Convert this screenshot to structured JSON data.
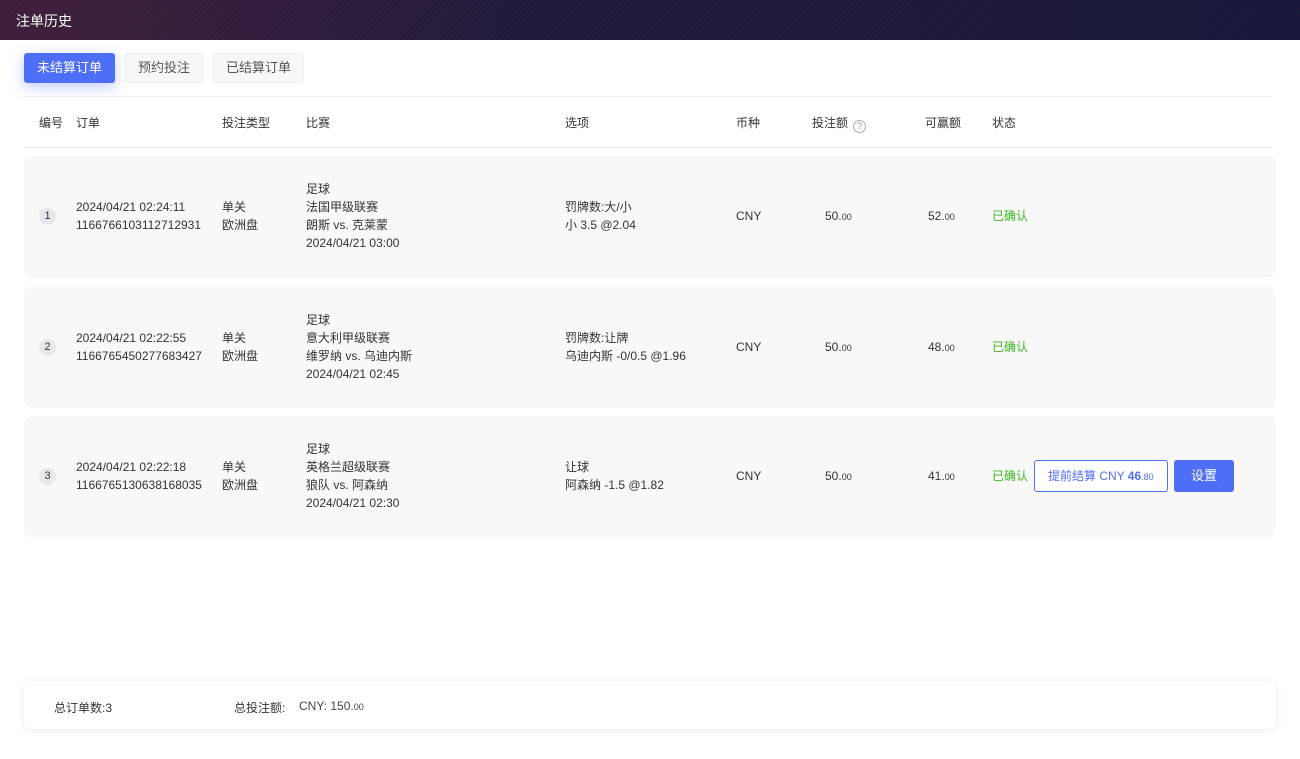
{
  "title": "注单历史",
  "tabs": [
    "未结算订单",
    "预约投注",
    "已结算订单"
  ],
  "columns": {
    "no": "编号",
    "order": "订单",
    "type": "投注类型",
    "match": "比赛",
    "option": "选项",
    "currency": "币种",
    "stake": "投注额",
    "win": "可赢额",
    "status": "状态"
  },
  "help_icon": "?",
  "rows": [
    {
      "no": "1",
      "time": "2024/04/21 02:24:11",
      "id": "1166766103112712931",
      "type1": "单关",
      "type2": "欧洲盘",
      "sport": "足球",
      "league": "法国甲级联赛",
      "teams": "朗斯 vs. 克莱蒙",
      "match_time": "2024/04/21 03:00",
      "opt1": "罚牌数:大/小",
      "opt2": "小 3.5 @2.04",
      "currency": "CNY",
      "stake_int": "50.",
      "stake_dec": "00",
      "win_int": "52.",
      "win_dec": "00",
      "status": "已确认"
    },
    {
      "no": "2",
      "time": "2024/04/21 02:22:55",
      "id": "1166765450277683427",
      "type1": "单关",
      "type2": "欧洲盘",
      "sport": "足球",
      "league": "意大利甲级联赛",
      "teams": "维罗纳 vs. 乌迪内斯",
      "match_time": "2024/04/21 02:45",
      "opt1": "罚牌数:让牌",
      "opt2": "乌迪内斯 -0/0.5 @1.96",
      "currency": "CNY",
      "stake_int": "50.",
      "stake_dec": "00",
      "win_int": "48.",
      "win_dec": "00",
      "status": "已确认"
    },
    {
      "no": "3",
      "time": "2024/04/21 02:22:18",
      "id": "1166765130638168035",
      "type1": "单关",
      "type2": "欧洲盘",
      "sport": "足球",
      "league": "英格兰超级联赛",
      "teams": "狼队 vs. 阿森纳",
      "match_time": "2024/04/21 02:30",
      "opt1": "让球",
      "opt2": "阿森纳 -1.5 @1.82",
      "currency": "CNY",
      "stake_int": "50.",
      "stake_dec": "00",
      "win_int": "41.",
      "win_dec": "00",
      "status": "已确认",
      "early_label": "提前结算 CNY ",
      "early_int": "46",
      "early_dec": ".80",
      "settings_label": "设置"
    }
  ],
  "footer": {
    "total_orders": "总订单数:3",
    "total_stake_label": "总投注额:",
    "total_stake_int": "CNY: 150.",
    "total_stake_dec": "00"
  }
}
